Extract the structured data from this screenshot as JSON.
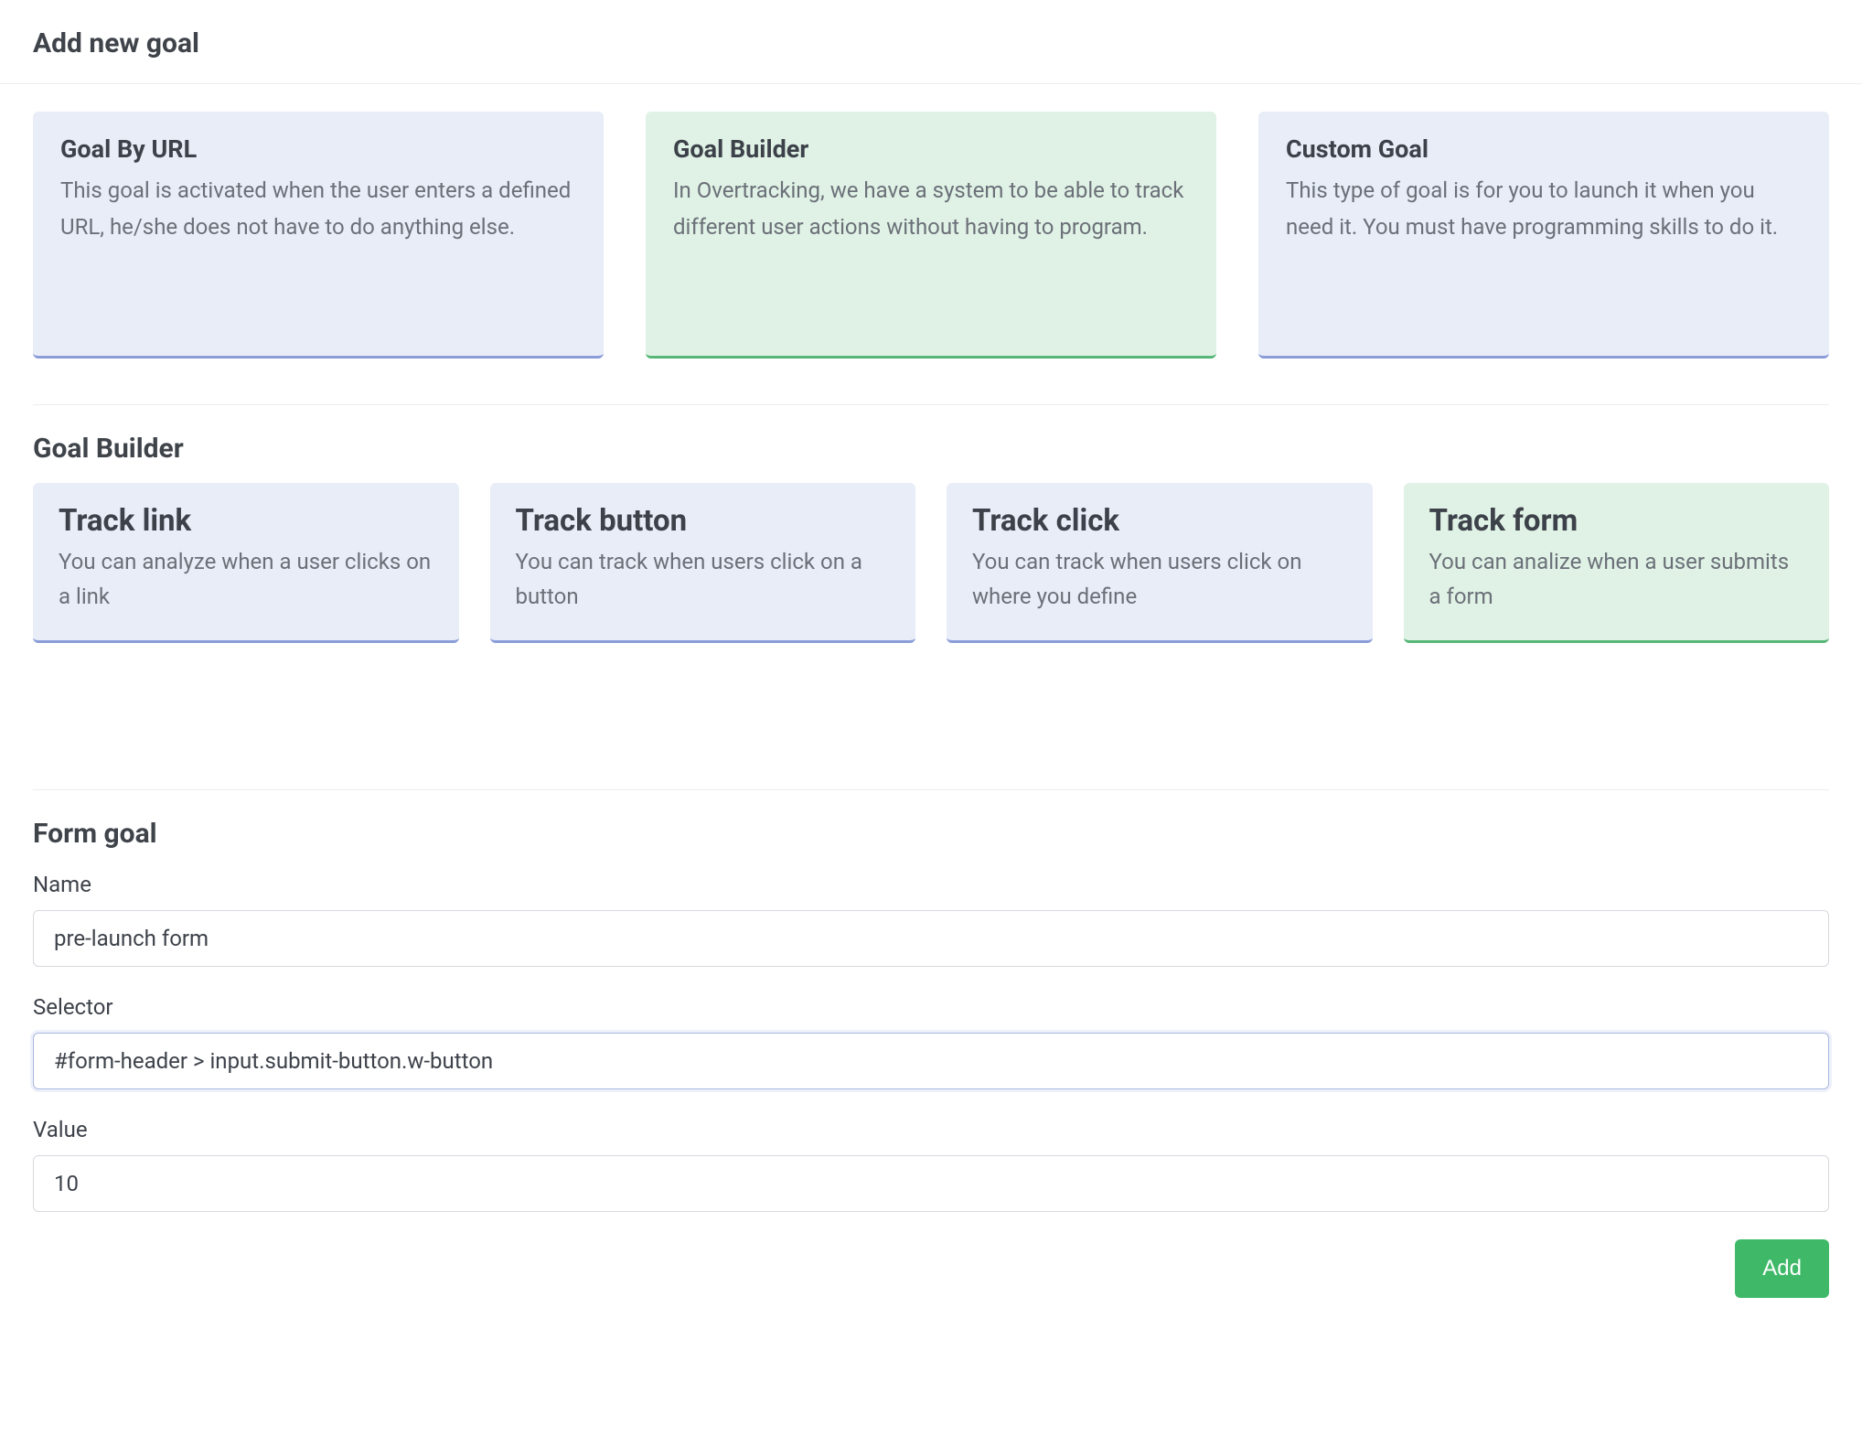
{
  "header": {
    "title": "Add new goal"
  },
  "goalTypes": [
    {
      "title": "Goal By URL",
      "desc": "This goal is activated when the user enters a defined URL, he/she does not have to do anything else.",
      "selected": false
    },
    {
      "title": "Goal Builder",
      "desc": "In Overtracking, we have a system to be able to track different user actions without having to program.",
      "selected": true
    },
    {
      "title": "Custom Goal",
      "desc": "This type of goal is for you to launch it when you need it. You must have programming skills to do it.",
      "selected": false
    }
  ],
  "builder": {
    "title": "Goal Builder",
    "options": [
      {
        "title": "Track link",
        "desc": "You can analyze when a user clicks on a link",
        "selected": false
      },
      {
        "title": "Track button",
        "desc": "You can track when users click on a button",
        "selected": false
      },
      {
        "title": "Track click",
        "desc": "You can track when users click on where you define",
        "selected": false
      },
      {
        "title": "Track form",
        "desc": "You can analize when a user submits a form",
        "selected": true
      }
    ]
  },
  "form": {
    "title": "Form goal",
    "nameLabel": "Name",
    "nameValue": "pre-launch form",
    "selectorLabel": "Selector",
    "selectorValue": "#form-header > input.submit-button.w-button",
    "valueLabel": "Value",
    "valueValue": "10",
    "addButton": "Add"
  }
}
